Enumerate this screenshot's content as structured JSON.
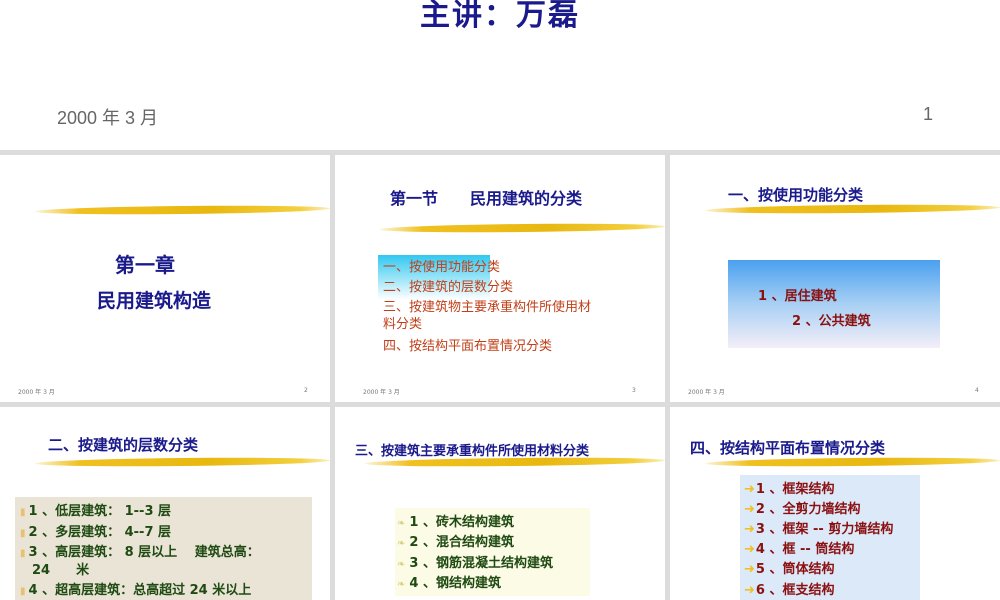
{
  "title_slide": {
    "lecturer": "主讲：万磊",
    "date": "2000 年 3 月",
    "page": "1"
  },
  "slides": [
    {
      "page": "2",
      "date": "2000 年 3 月",
      "chapter": "第一章",
      "chapter_title": "民用建筑构造"
    },
    {
      "page": "3",
      "date": "2000 年 3 月",
      "title": "第一节　　民用建筑的分类",
      "items": [
        "一、按使用功能分类",
        "二、按建筑的层数分类",
        "三、按建筑物主要承重构件所使用材",
        "料分类",
        "四、按结构平面布置情况分类"
      ]
    },
    {
      "page": "4",
      "date": "2000 年 3 月",
      "title": "一、按使用功能分类",
      "items": [
        "1 、居住建筑",
        "2 、公共建筑"
      ]
    },
    {
      "title": "二、按建筑的层数分类",
      "items": [
        "1 、低层建筑： 1--3 层",
        "2 、多层建筑： 4--7 层",
        "3 、高层建筑： 8 层以上　  建筑总高：",
        "24　　米",
        "4 、超高层建筑：总高超过 24 米以上"
      ]
    },
    {
      "title": "三、按建筑主要承重构件所使用材料分类",
      "items": [
        "1 、砖木结构建筑",
        "2 、混合结构建筑",
        "3 、钢筋混凝土结构建筑",
        "4 、钢结构建筑"
      ]
    },
    {
      "title": "四、按结构平面布置情况分类",
      "items": [
        "1 、框架结构",
        "2 、全剪力墙结构",
        "3 、框架 -- 剪力墙结构",
        "4 、框 -- 筒结构",
        "5 、筒体结构",
        "6 、框支结构"
      ]
    }
  ]
}
